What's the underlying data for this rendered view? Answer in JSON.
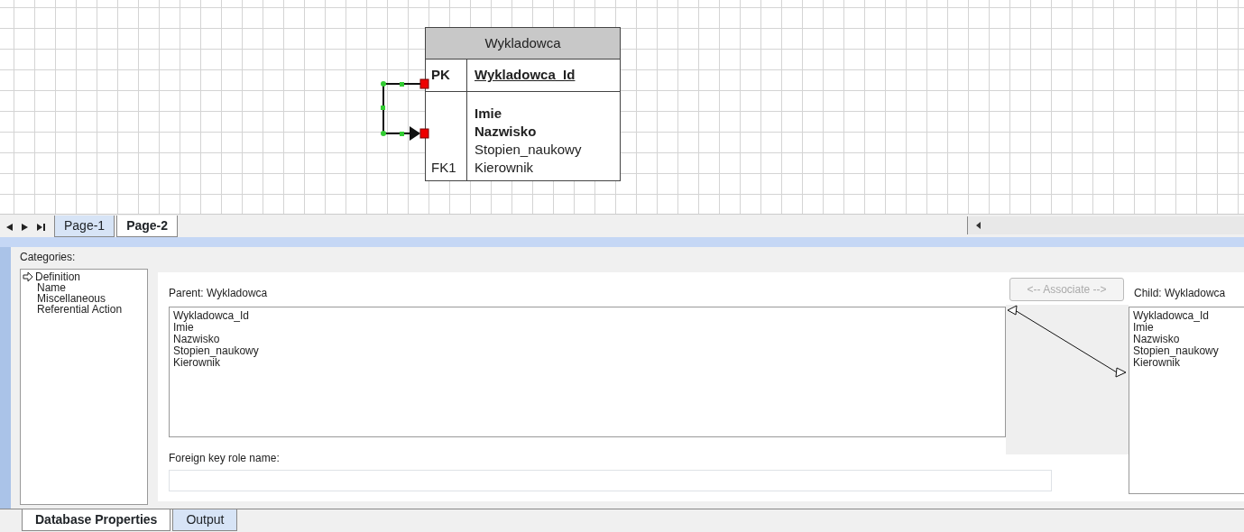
{
  "diagram": {
    "entity": {
      "title": "Wykladowca",
      "key_rows": [
        {
          "key": "PK",
          "name": "Wykladowca_Id"
        }
      ],
      "attributes": [
        {
          "name": "Imie",
          "bold": true
        },
        {
          "name": "Nazwisko",
          "bold": true
        },
        {
          "name": "Stopien_naukowy",
          "bold": false
        },
        {
          "key": "FK1",
          "name": "Kierownik",
          "bold": false
        }
      ]
    }
  },
  "page_tabs": [
    {
      "label": "Page-1",
      "selected": false
    },
    {
      "label": "Page-2",
      "selected": true
    }
  ],
  "properties": {
    "categories_label": "Categories:",
    "categories": [
      {
        "label": "Definition",
        "selected": true
      },
      {
        "label": "Name",
        "selected": false
      },
      {
        "label": "Miscellaneous",
        "selected": false
      },
      {
        "label": "Referential Action",
        "selected": false
      }
    ],
    "parent": {
      "label": "Parent: Wykladowca",
      "items": [
        "Wykladowca_Id",
        "Imie",
        "Nazwisko",
        "Stopien_naukowy",
        "Kierownik"
      ]
    },
    "associate_button": {
      "label": "<-- Associate -->",
      "disabled": true
    },
    "child": {
      "label": "Child: Wykladowca",
      "items": [
        "Wykladowca_Id",
        "Imie",
        "Nazwisko",
        "Stopien_naukowy",
        "Kierownik"
      ]
    },
    "role_name_label": "Foreign key role name:"
  },
  "bottom_tabs": [
    {
      "label": "Database Properties",
      "selected": true
    },
    {
      "label": "Output",
      "selected": false
    }
  ]
}
